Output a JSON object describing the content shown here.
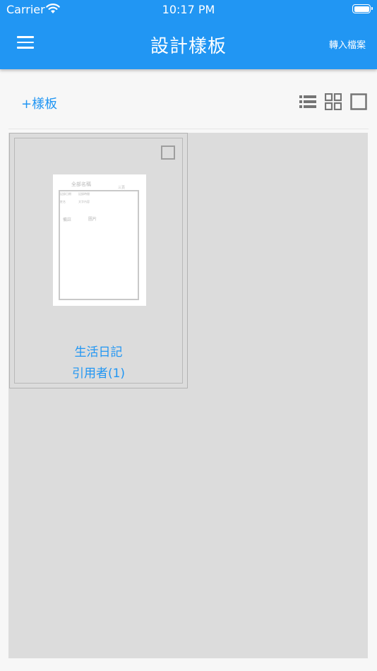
{
  "status_bar": {
    "carrier": "Carrier",
    "time": "10:17 PM"
  },
  "header": {
    "title": "設計樣板",
    "import_label": "轉入檔案",
    "background_color": "#2196f3"
  },
  "toolbar": {
    "add_label": "+樣板",
    "view_modes": [
      "list",
      "grid",
      "single"
    ]
  },
  "templates": [
    {
      "name": "生活日記",
      "users_label": "引用者(1)",
      "checked": false,
      "thumbnail": {
        "title": "全部名稱",
        "corner": "三頁",
        "fields": [
          "記錄日期",
          "記錄時間",
          "姓名",
          "文字內容"
        ],
        "notes": [
          "備註",
          "圖片"
        ]
      }
    }
  ],
  "colors": {
    "accent": "#2196f3",
    "grid_background": "#dcdcdc",
    "page_background": "#f7f7f7"
  }
}
